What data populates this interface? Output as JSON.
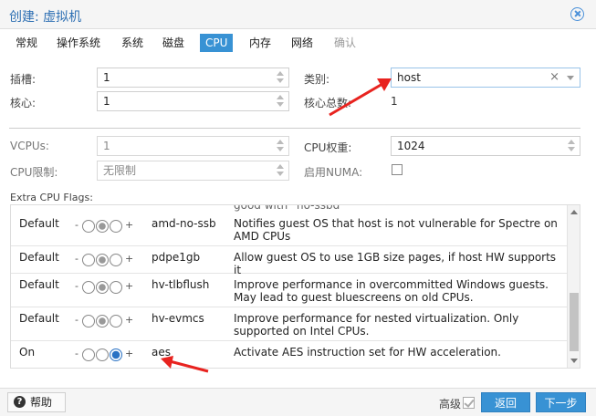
{
  "window": {
    "title": "创建: 虚拟机"
  },
  "tabs": [
    {
      "label": "常规"
    },
    {
      "label": "操作系统"
    },
    {
      "label": "系统"
    },
    {
      "label": "磁盘"
    },
    {
      "label": "CPU"
    },
    {
      "label": "内存"
    },
    {
      "label": "网络"
    },
    {
      "label": "确认"
    }
  ],
  "active_tab": "CPU",
  "form": {
    "sockets_label": "插槽:",
    "sockets_value": "1",
    "cores_label": "核心:",
    "cores_value": "1",
    "type_label": "类别:",
    "type_value": "host",
    "total_cores_label": "核心总数:",
    "total_cores_value": "1",
    "vcpus_label": "VCPUs:",
    "vcpus_value": "1",
    "cpu_units_label": "CPU权重:",
    "cpu_units_value": "1024",
    "cpu_limit_label": "CPU限制:",
    "cpu_limit_value": "无限制",
    "numa_label": "启用NUMA:",
    "numa_checked": false,
    "extra_flags_label": "Extra CPU Flags:"
  },
  "flags": {
    "partial_row_text": "good with `no-ssbd`",
    "rows": [
      {
        "state": "Default",
        "name": "amd-no-ssb",
        "description": "Notifies guest OS that host is not vulnerable for Spectre on AMD CPUs",
        "selected": "middle"
      },
      {
        "state": "Default",
        "name": "pdpe1gb",
        "description": "Allow guest OS to use 1GB size pages, if host HW supports it",
        "selected": "middle"
      },
      {
        "state": "Default",
        "name": "hv-tlbflush",
        "description": "Improve performance in overcommitted Windows guests. May lead to guest bluescreens on old CPUs.",
        "selected": "middle"
      },
      {
        "state": "Default",
        "name": "hv-evmcs",
        "description": "Improve performance for nested virtualization. Only supported on Intel CPUs.",
        "selected": "middle"
      },
      {
        "state": "On",
        "name": "aes",
        "description": "Activate AES instruction set for HW acceleration.",
        "selected": "right"
      }
    ],
    "minus": "-",
    "plus": "+"
  },
  "footer": {
    "help_label": "帮助",
    "advanced_label": "高级",
    "advanced_checked": true,
    "back_label": "返回",
    "next_label": "下一步"
  },
  "colors": {
    "accent": "#3892d4",
    "annotation_arrow": "#e8231f"
  }
}
